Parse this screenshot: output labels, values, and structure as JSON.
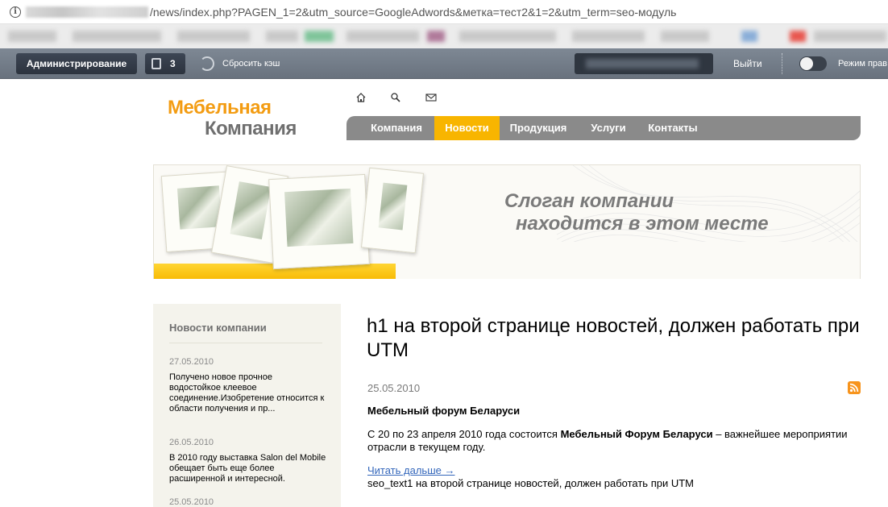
{
  "browser": {
    "url_path": "/news/index.php?PAGEN_1=2&utm_source=GoogleAdwords&метка=тест2&1=2&utm_term=seo-модуль"
  },
  "admin_panel": {
    "admin_label": "Администрирование",
    "notifications_count": "3",
    "reset_cache_label": "Сбросить кэш",
    "logout_label": "Выйти",
    "edit_mode_label": "Режим прав"
  },
  "header": {
    "logo_line1": "Мебельная",
    "logo_line2": "Компания",
    "icons": [
      "home-icon",
      "search-icon",
      "mail-icon"
    ]
  },
  "nav": {
    "items": [
      {
        "label": "Компания",
        "active": false
      },
      {
        "label": "Новости",
        "active": true
      },
      {
        "label": "Продукция",
        "active": false
      },
      {
        "label": "Услуги",
        "active": false
      },
      {
        "label": "Контакты",
        "active": false
      }
    ]
  },
  "banner": {
    "slogan_line1": "Слоган компании",
    "slogan_line2": "находится в этом месте"
  },
  "sidebar": {
    "title": "Новости компании",
    "items": [
      {
        "date": "27.05.2010",
        "text": "Получено новое прочное водостойкое клеевое соединение.Изобретение относится к области получения и пр..."
      },
      {
        "date": "26.05.2010",
        "text": "В 2010 году выставка Salon del Mobile обещает быть еще более расширенной и интересной."
      },
      {
        "date": "25.05.2010",
        "text": ""
      }
    ]
  },
  "main": {
    "h1": "h1 на второй странице новостей, должен работать при UTM",
    "news_date": "25.05.2010",
    "news_title": "Мебельный форум Беларуси",
    "para_part1": "С 20 по 23 апреля 2010 года состоится ",
    "para_bold": "Мебельный Форум Беларуси",
    "para_part2": " – важнейшее мероприятии отрасли в текущем году.",
    "read_more": "Читать дальше →",
    "seo_text": "seo_text1 на второй странице новостей, должен работать при UTM"
  },
  "colors": {
    "accent_yellow": "#f8b500",
    "logo_orange": "#f39c12",
    "nav_gray": "#8a8a8a",
    "admin_bar": "#6e7783"
  }
}
